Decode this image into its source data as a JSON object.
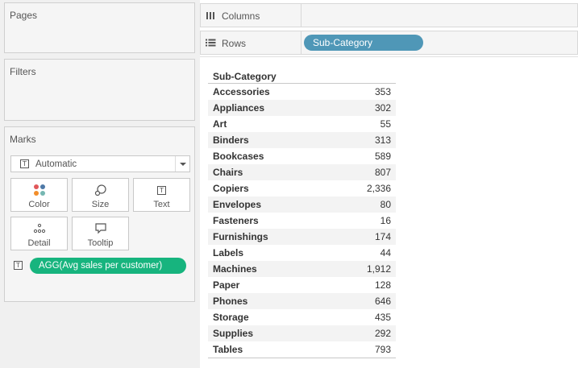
{
  "cards": {
    "pages_title": "Pages",
    "filters_title": "Filters",
    "marks_title": "Marks"
  },
  "marks": {
    "mark_type": "Automatic",
    "buttons": {
      "color": "Color",
      "size": "Size",
      "text": "Text",
      "detail": "Detail",
      "tooltip": "Tooltip"
    },
    "field_pill": "AGG(Avg sales per customer)",
    "field_pill_color": "#17b47e"
  },
  "shelves": {
    "columns_label": "Columns",
    "rows_label": "Rows",
    "rows_pill": "Sub-Category",
    "rows_pill_color": "#4f97b7"
  },
  "table": {
    "header": "Sub-Category",
    "rows": [
      {
        "category": "Accessories",
        "value": "353"
      },
      {
        "category": "Appliances",
        "value": "302"
      },
      {
        "category": "Art",
        "value": "55"
      },
      {
        "category": "Binders",
        "value": "313"
      },
      {
        "category": "Bookcases",
        "value": "589"
      },
      {
        "category": "Chairs",
        "value": "807"
      },
      {
        "category": "Copiers",
        "value": "2,336"
      },
      {
        "category": "Envelopes",
        "value": "80"
      },
      {
        "category": "Fasteners",
        "value": "16"
      },
      {
        "category": "Furnishings",
        "value": "174"
      },
      {
        "category": "Labels",
        "value": "44"
      },
      {
        "category": "Machines",
        "value": "1,912"
      },
      {
        "category": "Paper",
        "value": "128"
      },
      {
        "category": "Phones",
        "value": "646"
      },
      {
        "category": "Storage",
        "value": "435"
      },
      {
        "category": "Supplies",
        "value": "292"
      },
      {
        "category": "Tables",
        "value": "793"
      }
    ]
  },
  "icons": {
    "columns": "columns-icon",
    "rows": "rows-icon",
    "text": "text-mark-icon",
    "color": "color-dots-icon",
    "size": "size-icon",
    "detail": "detail-dots-icon",
    "tooltip": "tooltip-bubble-icon"
  }
}
